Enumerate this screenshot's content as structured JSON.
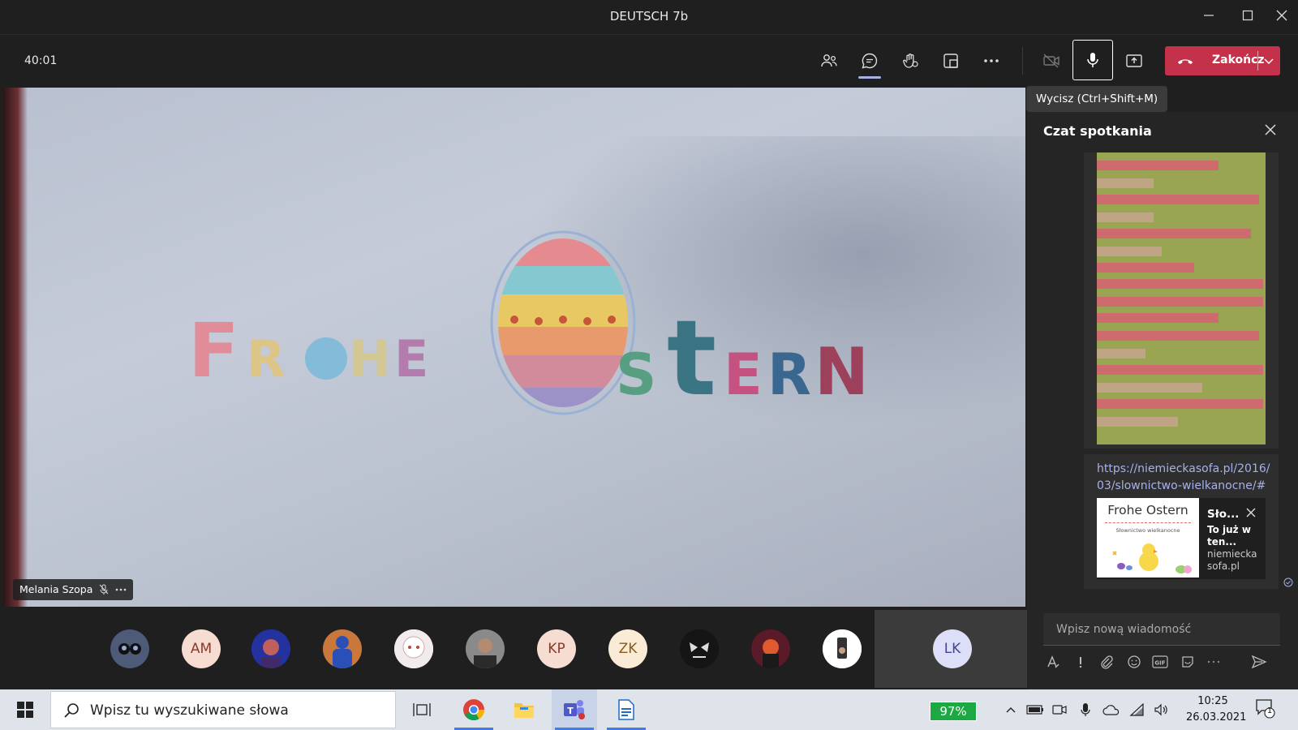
{
  "window": {
    "title": "DEUTSCH 7b"
  },
  "toolbar": {
    "timer": "40:01",
    "end_label": "Zakończ",
    "mute_tooltip": "Wycisz (Ctrl+Shift+M)"
  },
  "video": {
    "participant_name": "Melania Szopa",
    "sign_word1": "FROHE",
    "sign_word2": "STERN"
  },
  "participants": [
    {
      "initials": ""
    },
    {
      "initials": "AM"
    },
    {
      "initials": ""
    },
    {
      "initials": ""
    },
    {
      "initials": ""
    },
    {
      "initials": ""
    },
    {
      "initials": "KP"
    },
    {
      "initials": "ZK"
    },
    {
      "initials": ""
    },
    {
      "initials": ""
    },
    {
      "initials": ""
    },
    {
      "initials": "LK"
    }
  ],
  "chat": {
    "title": "Czat spotkania",
    "link_message": "https://niemieckasofa.pl/2016/03/slownictwo-wielkanocne/#",
    "preview": {
      "image_title": "Frohe Ostern",
      "image_subtitle": "Słownictwo wielkanocne",
      "title": "Sło...",
      "description": "To już w ten...",
      "source": "niemiecka sofa.pl"
    },
    "compose_placeholder": "Wpisz nową wiadomość"
  },
  "taskbar": {
    "search_placeholder": "Wpisz tu wyszukiwane słowa",
    "battery": "97%",
    "time": "10:25",
    "date": "26.03.2021",
    "notification_count": "1"
  }
}
